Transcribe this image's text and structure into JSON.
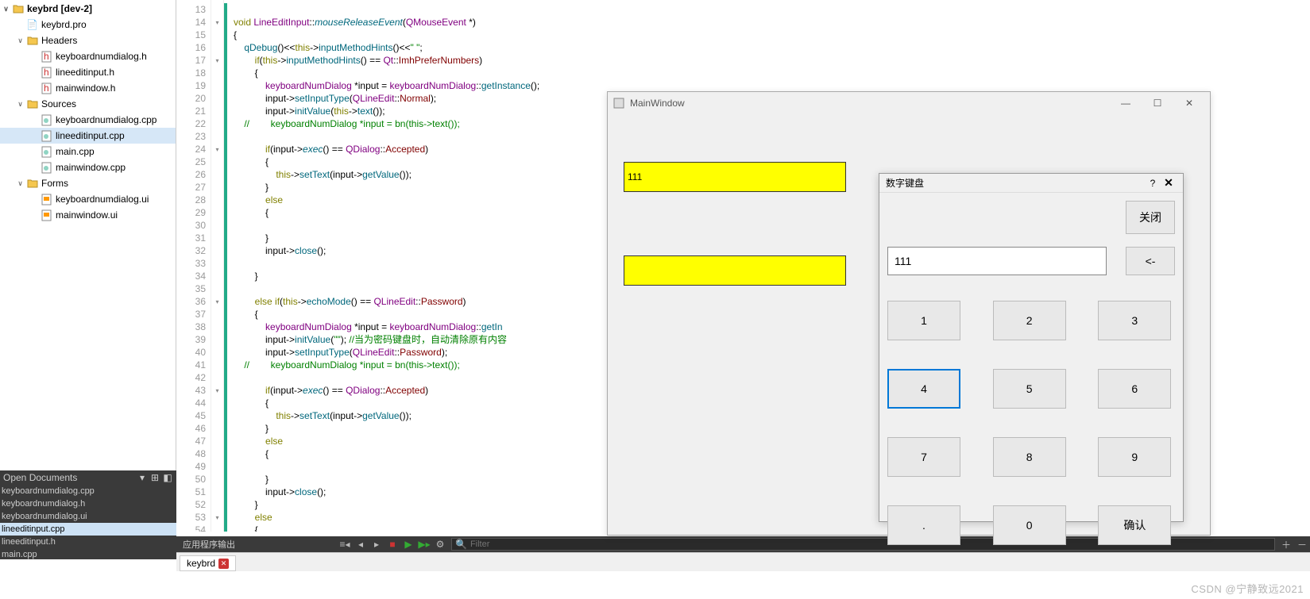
{
  "project": {
    "name": "keybrd [dev-2]",
    "pro_file": "keybrd.pro",
    "headers_label": "Headers",
    "headers": [
      "keyboardnumdialog.h",
      "lineeditinput.h",
      "mainwindow.h"
    ],
    "sources_label": "Sources",
    "sources": [
      "keyboardnumdialog.cpp",
      "lineeditinput.cpp",
      "main.cpp",
      "mainwindow.cpp"
    ],
    "forms_label": "Forms",
    "forms": [
      "keyboardnumdialog.ui",
      "mainwindow.ui"
    ]
  },
  "editor": {
    "line_start": 13,
    "line_end": 54,
    "folds": {
      "14": "v",
      "17": "v",
      "24": "v",
      "36": "v",
      "43": "v",
      "53": "v"
    }
  },
  "code_lines": [
    "",
    "<span class='kw'>void</span> <span class='ty'>LineEditInput</span>::<span class='fn'>mouseReleaseEvent</span>(<span class='ty'>QMouseEvent</span> *)",
    "{",
    "    <span class='fn2'>qDebug</span>()&lt;&lt;<span class='kw'>this</span>-&gt;<span class='fn2'>inputMethodHints</span>()&lt;&lt;<span class='st'>\" \"</span>;",
    "        <span class='kw'>if</span>(<span class='kw'>this</span>-&gt;<span class='fn2'>inputMethodHints</span>() == <span class='ty'>Qt</span>::<span class='pp'>ImhPreferNumbers</span>)",
    "        {",
    "            <span class='ty'>keyboardNumDialog</span> *input = <span class='ty'>keyboardNumDialog</span>::<span class='fn2'>getInstance</span>();",
    "            input-&gt;<span class='fn2'>setInputType</span>(<span class='ty'>QLineEdit</span>::<span class='pp'>Normal</span>);",
    "            input-&gt;<span class='fn2'>initValue</span>(<span class='kw'>this</span>-&gt;<span class='fn2'>text</span>());",
    "    <span class='cm'>//        keyboardNumDialog *input = bn(this-&gt;text());</span>",
    "",
    "            <span class='kw'>if</span>(input-&gt;<span class='fn'>exec</span>() == <span class='ty'>QDialog</span>::<span class='pp'>Accepted</span>)",
    "            {",
    "                <span class='kw'>this</span>-&gt;<span class='fn2'>setText</span>(input-&gt;<span class='fn2'>getValue</span>());",
    "            }",
    "            <span class='kw'>else</span>",
    "            {",
    "",
    "            }",
    "            input-&gt;<span class='fn2'>close</span>();",
    "",
    "        }",
    "",
    "        <span class='kw'>else</span> <span class='kw'>if</span>(<span class='kw'>this</span>-&gt;<span class='fn2'>echoMode</span>() == <span class='ty'>QLineEdit</span>::<span class='pp'>Password</span>)",
    "        {",
    "            <span class='ty'>keyboardNumDialog</span> *input = <span class='ty'>keyboardNumDialog</span>::<span class='fn2'>getIn</span>",
    "            input-&gt;<span class='fn2'>initValue</span>(<span class='st'>\"\"</span>); <span class='cm'>//当为密码键盘时，自动清除原有内容</span>",
    "            input-&gt;<span class='fn2'>setInputType</span>(<span class='ty'>QLineEdit</span>::<span class='pp'>Password</span>);",
    "    <span class='cm'>//        keyboardNumDialog *input = bn(this-&gt;text());</span>",
    "",
    "            <span class='kw'>if</span>(input-&gt;<span class='fn'>exec</span>() == <span class='ty'>QDialog</span>::<span class='pp'>Accepted</span>)",
    "            {",
    "                <span class='kw'>this</span>-&gt;<span class='fn2'>setText</span>(input-&gt;<span class='fn2'>getValue</span>());",
    "            }",
    "            <span class='kw'>else</span>",
    "            {",
    "",
    "            }",
    "            input-&gt;<span class='fn2'>close</span>();",
    "        }",
    "        <span class='kw'>else</span>",
    "        {"
  ],
  "open_docs": {
    "title": "Open Documents",
    "items": [
      "keyboardnumdialog.cpp",
      "keyboardnumdialog.h",
      "keyboardnumdialog.ui",
      "lineeditinput.cpp",
      "lineeditinput.h",
      "main.cpp"
    ],
    "current": "lineeditinput.cpp"
  },
  "output_bar": {
    "label": "应用程序输出",
    "filter_placeholder": "Filter"
  },
  "tab": {
    "label": "keybrd"
  },
  "mainwin": {
    "title": "MainWindow",
    "field1": "111",
    "field2": ""
  },
  "keypad": {
    "title": "数字键盘",
    "close_label": "关闭",
    "back_label": "<-",
    "display": "111",
    "keys": [
      "1",
      "2",
      "3",
      "4",
      "5",
      "6",
      "7",
      "8",
      "9",
      ".",
      "0",
      "确认"
    ],
    "active_key": "4"
  },
  "watermark": "CSDN @宁静致远2021"
}
